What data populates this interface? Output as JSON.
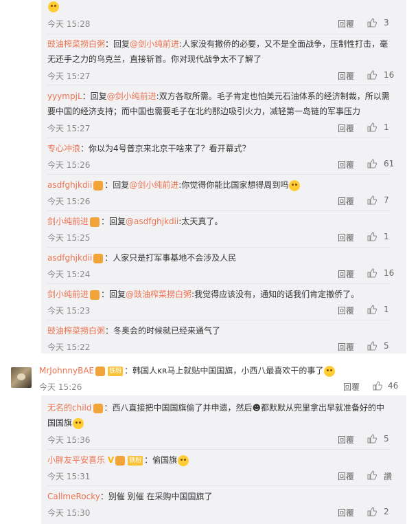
{
  "comments": [
    {
      "time": "今天 15:28",
      "reply": "回覆",
      "likes": "3"
    },
    {
      "user": "豉油榨菜撈白粥",
      "prefix": "：回复",
      "mention": "@剑小纯前进",
      "text": ":人家没有撤侨的必要，又不是全面战争，压制性打击，毫无还手之力的乌克兰，直接斩首。你对现代战争太不了解了",
      "time": "今天 15:27",
      "reply": "回覆",
      "likes": "16"
    },
    {
      "user": "yyympjL",
      "prefix": "：回复",
      "mention": "@剑小纯前进",
      "text": ":双方各取所需。毛子肯定也怕美元石油体系的经济制裁，所以需要中国的经济支持；而中国也需要毛子在北约那边吸引火力，减轻第一岛链的军事压力",
      "time": "今天 15:27",
      "reply": "回覆",
      "likes": "1"
    },
    {
      "user": "专心冲浪",
      "text": "：你以为4号普京来北京干啥来了？看开幕式？",
      "time": "今天 15:26",
      "reply": "回覆",
      "likes": "61"
    },
    {
      "user": "asdfghjkdii",
      "prefix": "：回复",
      "mention": "@剑小纯前进",
      "text": ":你觉得你能比国家想得周到吗",
      "time": "今天 15:26",
      "reply": "回覆",
      "likes": "7"
    },
    {
      "user": "剑小纯前进",
      "prefix": "：回复",
      "mention": "@asdfghjkdii",
      "text": ":太天真了。",
      "time": "今天 15:25",
      "reply": "回覆",
      "likes": "1"
    },
    {
      "user": "asdfghjkdii",
      "text": "：人家只是打军事基地不会涉及人民",
      "time": "今天 15:24",
      "reply": "回覆",
      "likes": "16"
    },
    {
      "user": "剑小纯前进",
      "prefix": "：回复",
      "mention": "@豉油榨菜撈白粥",
      "text": ":我觉得应该没有，通知的话我们肯定撤侨了。",
      "time": "今天 15:23",
      "reply": "回覆",
      "likes": "1"
    },
    {
      "user": "豉油榨菜撈白粥",
      "text": "：冬奥会的时候就已经来通气了",
      "time": "今天 15:22",
      "reply": "回覆",
      "likes": "5"
    }
  ],
  "main": {
    "user": "MrJohnnyBAE",
    "badge": "铁粉",
    "text": "：韩国人ᴋʀ马上就贴中国国旗，小西八最喜欢干的事了",
    "time": "今天 15:26",
    "reply": "回覆",
    "likes": "46"
  },
  "subs": [
    {
      "user": "无名的child",
      "text": "：西八直接把中国国旗偷了并申遗，然后☻都默默从兜里拿出早就准备好的中国国旗",
      "time": "今天 15:36",
      "reply": "回覆",
      "likes": "5"
    },
    {
      "user": "小胖友平安喜乐",
      "v": "V",
      "badge": "铁粉",
      "text": "：偷国旗",
      "time": "今天 15:31",
      "reply": "回覆",
      "likes": "讚"
    },
    {
      "user": "CallmeRocky",
      "text": "：别催 别催 在采购中国国旗了",
      "time": "今天 15:30",
      "reply": "回覆",
      "likes": "2"
    }
  ]
}
